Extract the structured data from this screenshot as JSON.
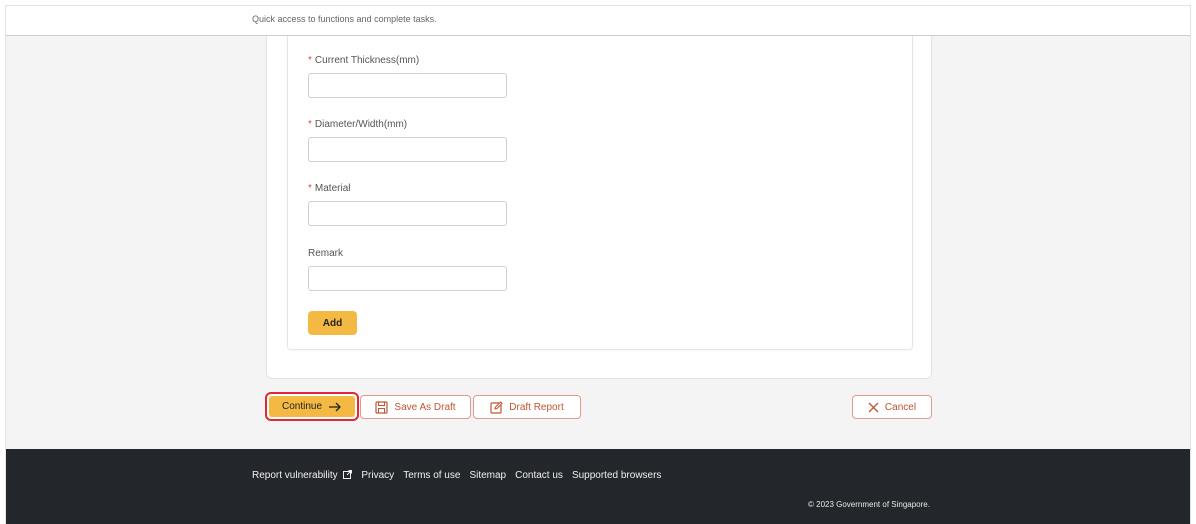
{
  "header": {
    "subtitle": "Quick access to functions and complete tasks."
  },
  "form": {
    "fields": [
      {
        "label": "Current Thickness(mm)",
        "required": true,
        "value": ""
      },
      {
        "label": "Diameter/Width(mm)",
        "required": true,
        "value": ""
      },
      {
        "label": "Material",
        "required": true,
        "value": ""
      },
      {
        "label": "Remark",
        "required": false,
        "value": ""
      }
    ],
    "required_marker": "*",
    "add_label": "Add"
  },
  "actions": {
    "continue_label": "Continue",
    "save_draft_label": "Save As Draft",
    "draft_report_label": "Draft Report",
    "cancel_label": "Cancel"
  },
  "footer": {
    "links": [
      "Report vulnerability",
      "Privacy",
      "Terms of use",
      "Sitemap",
      "Contact us",
      "Supported browsers"
    ],
    "copyright": "© 2023 Government of Singapore."
  },
  "colors": {
    "accent": "#f4b942",
    "highlight": "#e0263a",
    "outline": "#e39a8a",
    "footer_bg": "#23262b"
  }
}
